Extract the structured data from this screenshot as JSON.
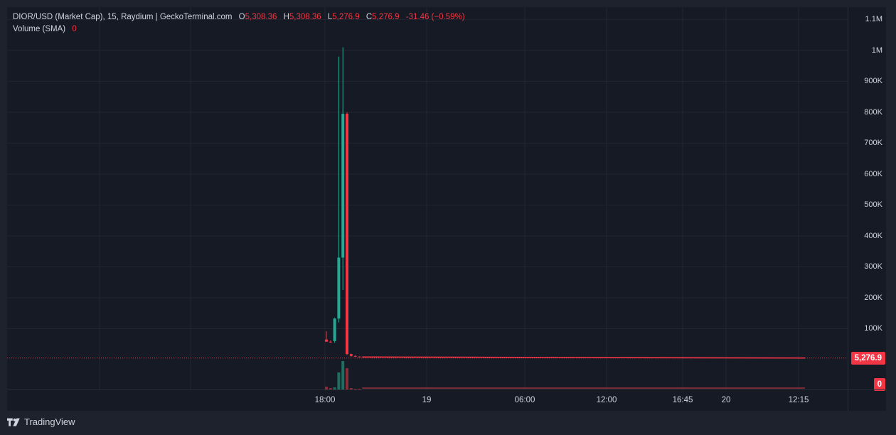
{
  "legend": {
    "title": "DIOR/USD (Market Cap), 15, Raydium | GeckoTerminal.com",
    "o_label": "O",
    "o_value": "5,308.36",
    "h_label": "H",
    "h_value": "5,308.36",
    "l_label": "L",
    "l_value": "5,276.9",
    "c_label": "C",
    "c_value": "5,276.9",
    "change": "-31.46 (−0.59%)",
    "volume_label": "Volume (SMA)",
    "volume_value": "0"
  },
  "price_tag": "5,276.9",
  "volume_tag": "0",
  "brand": "TradingView",
  "colors": {
    "up": "#22ab94",
    "down": "#f23645",
    "grid": "#232632",
    "bg": "#161a25"
  },
  "chart_data": {
    "type": "candlestick",
    "ylim": [
      0,
      1110000
    ],
    "yticks": [
      {
        "value": 100000,
        "label": "100K"
      },
      {
        "value": 200000,
        "label": "200K"
      },
      {
        "value": 300000,
        "label": "300K"
      },
      {
        "value": 400000,
        "label": "400K"
      },
      {
        "value": 500000,
        "label": "500K"
      },
      {
        "value": 600000,
        "label": "600K"
      },
      {
        "value": 700000,
        "label": "700K"
      },
      {
        "value": 800000,
        "label": "800K"
      },
      {
        "value": 900000,
        "label": "900K"
      },
      {
        "value": 1000000,
        "label": "1M"
      },
      {
        "value": 1100000,
        "label": "1.1M"
      }
    ],
    "xticks": [
      "18:00",
      "19",
      "06:00",
      "12:00",
      "16:45",
      "20",
      "12:15"
    ],
    "last_price": 5276.9,
    "candles": [
      {
        "o": 65000,
        "h": 92000,
        "l": 60000,
        "c": 58000
      },
      {
        "o": 58000,
        "h": 62000,
        "l": 55000,
        "c": 57000
      },
      {
        "o": 60000,
        "h": 135000,
        "l": 55000,
        "c": 133000
      },
      {
        "o": 133000,
        "h": 980000,
        "l": 120000,
        "c": 330000
      },
      {
        "o": 330000,
        "h": 1010000,
        "l": 225000,
        "c": 795000
      },
      {
        "o": 795000,
        "h": 800000,
        "l": 15000,
        "c": 18000
      },
      {
        "o": 18000,
        "h": 20000,
        "l": 9000,
        "c": 12000
      },
      {
        "o": 12000,
        "h": 14000,
        "l": 9000,
        "c": 10000
      },
      {
        "o": 10000,
        "h": 11000,
        "l": 8000,
        "c": 8500
      }
    ],
    "flat_series": {
      "from": 8500,
      "to": 5276.9
    }
  }
}
